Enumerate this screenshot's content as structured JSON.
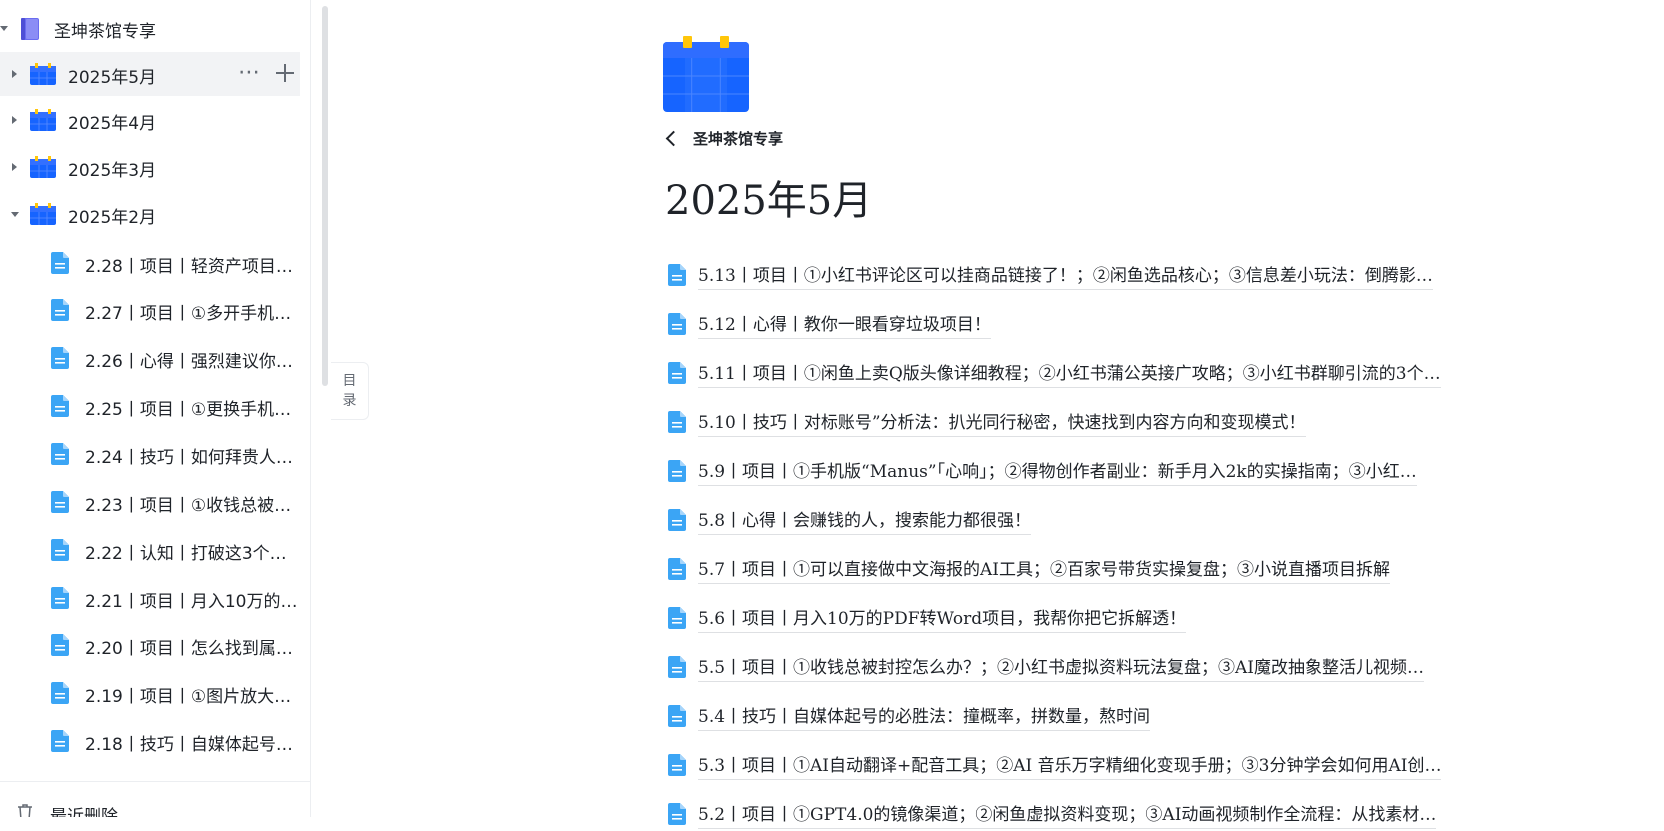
{
  "sidebar": {
    "root": {
      "label": "圣坤茶馆专享"
    },
    "months": [
      {
        "label": "2025年5月",
        "expanded": false,
        "selected": true
      },
      {
        "label": "2025年4月",
        "expanded": false,
        "selected": false
      },
      {
        "label": "2025年3月",
        "expanded": false,
        "selected": false
      },
      {
        "label": "2025年2月",
        "expanded": true,
        "selected": false
      }
    ],
    "feb_docs": [
      "2.28丨项目丨轻资产项目…",
      "2.27丨项目丨①多开手机…",
      "2.26丨心得丨强烈建议你…",
      "2.25丨项目丨①更换手机…",
      "2.24丨技巧丨如何拜贵人…",
      "2.23丨项目丨①收钱总被…",
      "2.22丨认知丨打破这3个…",
      "2.21丨项目丨月入10万的…",
      "2.20丨项目丨怎么找到属…",
      "2.19丨项目丨①图片放大…",
      "2.18丨技巧丨自媒体起号…"
    ],
    "trash_label": "最近删除"
  },
  "toc_tab": {
    "line1": "目",
    "line2": "录"
  },
  "breadcrumb": {
    "parent": "圣坤茶馆专享"
  },
  "page": {
    "title": "2025年5月",
    "documents": [
      "5.13丨项目丨①小红书评论区可以挂商品链接了！；②闲鱼选品核心；③信息差小玩法：倒腾影…",
      "5.12丨心得丨教你一眼看穿垃圾项目！",
      "5.11丨项目丨①闲鱼上卖Q版头像详细教程；②小红书蒲公英接广攻略；③小红书群聊引流的3个…",
      "5.10丨技巧丨对标账号”分析法：扒光同行秘密，快速找到内容方向和变现模式！",
      "5.9丨项目丨①手机版“Manus”「心响」；②得物创作者副业：新手月入2k的实操指南；③小红…",
      "5.8丨心得丨会赚钱的人，搜索能力都很强！",
      "5.7丨项目丨①可以直接做中文海报的AI工具；②百家号带货实操复盘；③小说直播项目拆解",
      "5.6丨项目丨月入10万的PDF转Word项目，我帮你把它拆解透！",
      "5.5丨项目丨①收钱总被封控怎么办？；②小红书虚拟资料玩法复盘；③AI魔改抽象整活儿视频…",
      "5.4丨技巧丨自媒体起号的必胜法：撞概率，拼数量，熬时间",
      "5.3丨项目丨①AI自动翻译+配音工具；②AI 音乐万字精细化变现手册；③3分钟学会如何用AI创…",
      "5.2丨项目丨①GPT4.0的镜像渠道；②闲鱼虚拟资料变现；③AI动画视频制作全流程：从找素材…"
    ]
  },
  "colors": {
    "calendar_blue": "#1664ff",
    "calendar_tab": "#ffc60a",
    "doc_blue": "#3ba5f5",
    "book_purple": "#6a6cf0"
  },
  "icons": [
    "book-icon",
    "calendar-icon",
    "doc-icon",
    "caret-right-icon",
    "caret-down-icon",
    "more-icon",
    "plus-icon",
    "back-chevron-icon",
    "trash-icon"
  ]
}
